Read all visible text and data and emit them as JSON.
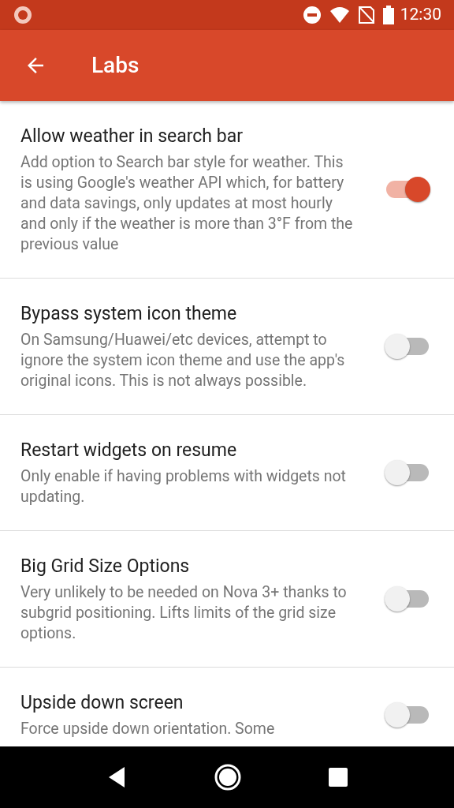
{
  "status_bar": {
    "time": "12:30"
  },
  "app_bar": {
    "title": "Labs"
  },
  "settings": [
    {
      "title": "Allow weather in search bar",
      "description": "Add option to Search bar style for weather. This is using Google's weather API which, for battery and data savings, only updates at most hourly and only if the weather is more than 3°F from the previous value",
      "on": true
    },
    {
      "title": "Bypass system icon theme",
      "description": "On Samsung/Huawei/etc devices, attempt to ignore the system icon theme and use the app's original icons. This is not always possible.",
      "on": false
    },
    {
      "title": "Restart widgets on resume",
      "description": "Only enable if having problems with widgets not updating.",
      "on": false
    },
    {
      "title": "Big Grid Size Options",
      "description": "Very unlikely to be needed on Nova 3+ thanks to subgrid positioning. Lifts limits of the grid size options.",
      "on": false
    },
    {
      "title": "Upside down screen",
      "description": "Force upside down orientation. Some",
      "on": false
    }
  ]
}
